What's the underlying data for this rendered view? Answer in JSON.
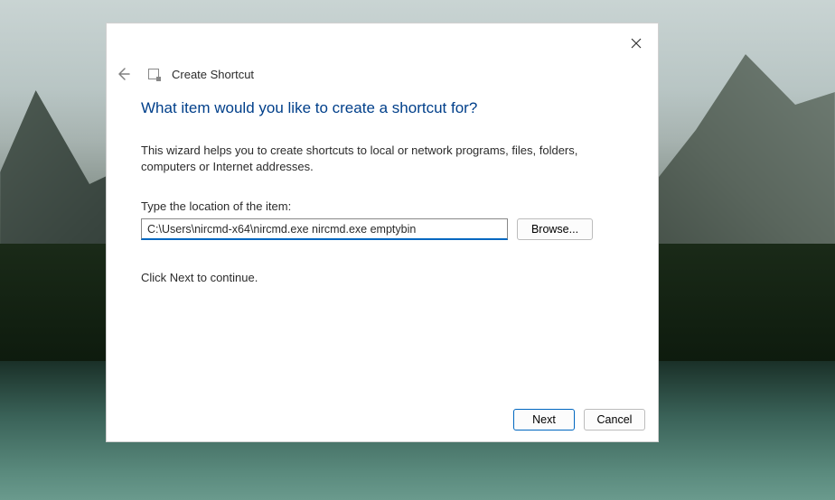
{
  "dialog": {
    "title": "Create Shortcut",
    "headline": "What item would you like to create a shortcut for?",
    "description": "This wizard helps you to create shortcuts to local or network programs, files, folders, computers or Internet addresses.",
    "field_label": "Type the location of the item:",
    "path_value": "C:\\Users\\nircmd-x64\\nircmd.exe nircmd.exe emptybin",
    "browse_label": "Browse...",
    "continue_text": "Click Next to continue.",
    "next_label": "Next",
    "cancel_label": "Cancel"
  }
}
